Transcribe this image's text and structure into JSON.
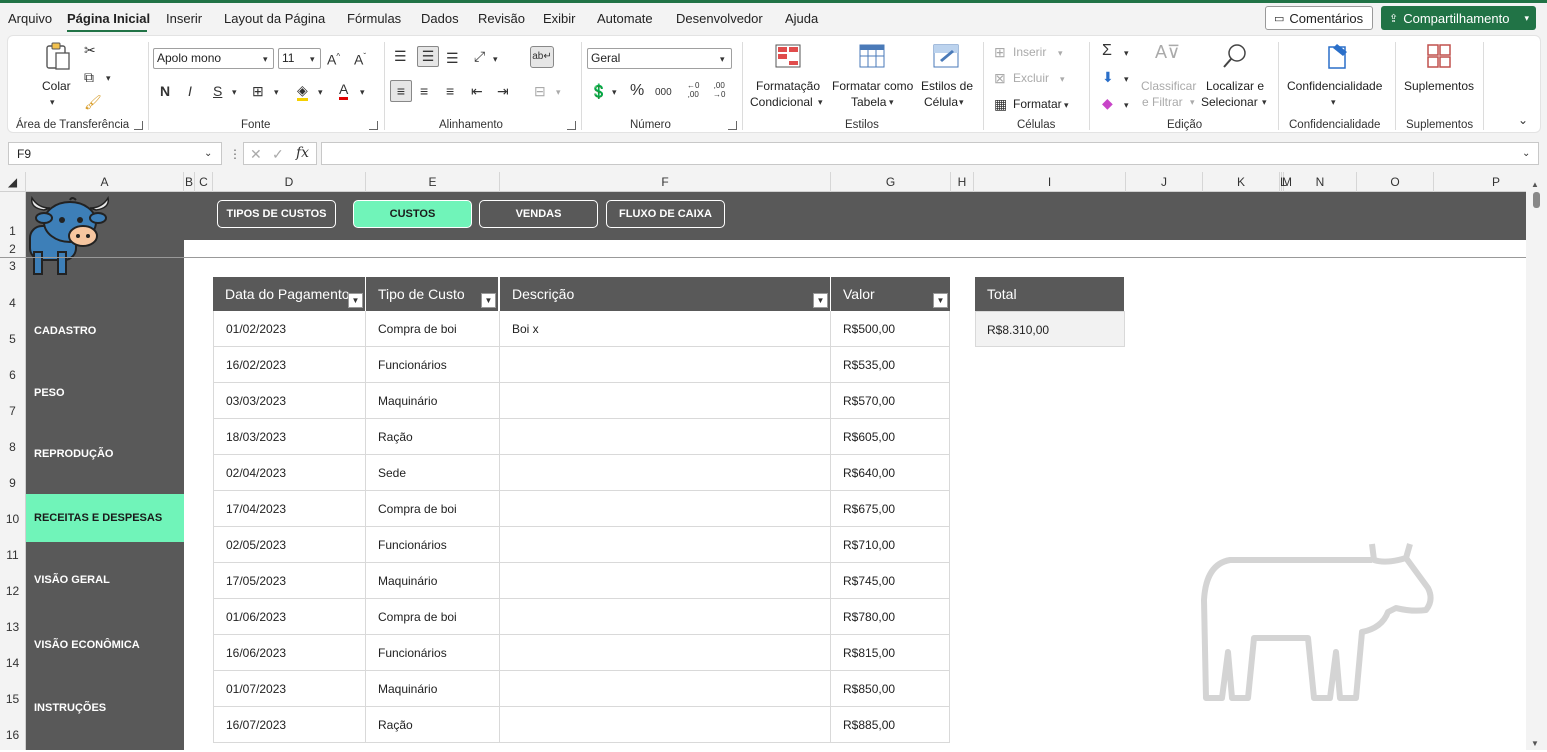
{
  "menu": {
    "items": [
      "Arquivo",
      "Página Inicial",
      "Inserir",
      "Layout da Página",
      "Fórmulas",
      "Dados",
      "Revisão",
      "Exibir",
      "Automate",
      "Desenvolvedor",
      "Ajuda"
    ],
    "comments_label": "Comentários",
    "share_label": "Compartilhamento"
  },
  "ribbon": {
    "clipboard": {
      "paste_label": "Colar",
      "group_label": "Área de Transferência"
    },
    "font": {
      "font_name": "Apolo mono",
      "font_size": "11",
      "bold": "N",
      "italic": "I",
      "underline": "S",
      "group_label": "Fonte"
    },
    "alignment": {
      "group_label": "Alinhamento"
    },
    "number": {
      "format": "Geral",
      "group_label": "Número"
    },
    "styles": {
      "cond_format_l1": "Formatação",
      "cond_format_l2": "Condicional",
      "format_table_l1": "Formatar como",
      "format_table_l2": "Tabela",
      "cell_styles_l1": "Estilos de",
      "cell_styles_l2": "Célula",
      "group_label": "Estilos"
    },
    "cells": {
      "insert": "Inserir",
      "delete": "Excluir",
      "format": "Formatar",
      "group_label": "Células"
    },
    "editing": {
      "sort_l1": "Classificar",
      "sort_l2": "e Filtrar",
      "find_l1": "Localizar e",
      "find_l2": "Selecionar",
      "group_label": "Edição"
    },
    "sensitivity": {
      "label": "Confidencialidade",
      "group_label": "Confidencialidade"
    },
    "addins": {
      "label": "Suplementos",
      "group_label": "Suplementos"
    }
  },
  "formula_bar": {
    "name_box": "F9",
    "fx": "fx",
    "formula": ""
  },
  "columns": [
    "A",
    "B",
    "C",
    "D",
    "E",
    "F",
    "G",
    "H",
    "I",
    "J",
    "K",
    "L",
    "M",
    "N",
    "O",
    "P"
  ],
  "rows": [
    "1",
    "2",
    "3",
    "4",
    "5",
    "6",
    "7",
    "8",
    "9",
    "10",
    "11",
    "12",
    "13",
    "14",
    "15",
    "16"
  ],
  "sidebar": {
    "items": [
      "CADASTRO",
      "PESO",
      "REPRODUÇÃO",
      "RECEITAS E DESPESAS",
      "VISÃO GERAL",
      "VISÃO ECONÔMICA",
      "INSTRUÇÕES"
    ],
    "active": "RECEITAS E DESPESAS"
  },
  "nav": {
    "buttons": [
      "TIPOS DE CUSTOS",
      "CUSTOS",
      "VENDAS",
      "FLUXO DE CAIXA"
    ],
    "active": "CUSTOS"
  },
  "table": {
    "headers": [
      "Data do Pagamento",
      "Tipo de Custo",
      "Descrição",
      "Valor"
    ],
    "rows": [
      [
        "01/02/2023",
        "Compra de boi",
        "Boi x",
        "R$500,00"
      ],
      [
        "16/02/2023",
        "Funcionários",
        "",
        "R$535,00"
      ],
      [
        "03/03/2023",
        "Maquinário",
        "",
        "R$570,00"
      ],
      [
        "18/03/2023",
        "Ração",
        "",
        "R$605,00"
      ],
      [
        "02/04/2023",
        "Sede",
        "",
        "R$640,00"
      ],
      [
        "17/04/2023",
        "Compra de boi",
        "",
        "R$675,00"
      ],
      [
        "02/05/2023",
        "Funcionários",
        "",
        "R$710,00"
      ],
      [
        "17/05/2023",
        "Maquinário",
        "",
        "R$745,00"
      ],
      [
        "01/06/2023",
        "Compra de boi",
        "",
        "R$780,00"
      ],
      [
        "16/06/2023",
        "Funcionários",
        "",
        "R$815,00"
      ],
      [
        "01/07/2023",
        "Maquinário",
        "",
        "R$850,00"
      ],
      [
        "16/07/2023",
        "Ração",
        "",
        "R$885,00"
      ]
    ]
  },
  "total": {
    "label": "Total",
    "value": "R$8.310,00"
  },
  "colors": {
    "accent_green": "#217346",
    "mint": "#70f4b9",
    "dark_gray": "#595959"
  }
}
